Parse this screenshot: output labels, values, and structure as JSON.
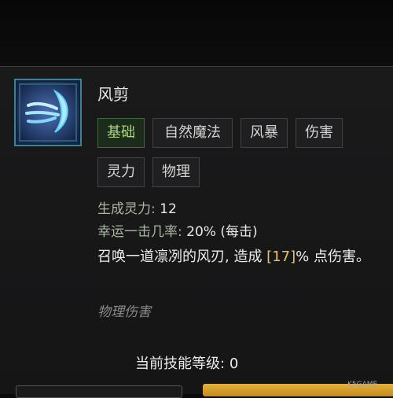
{
  "colors": {
    "accent": "#e8c25a",
    "tag_active": "#a9d67a",
    "panel_bg": "#1a1a1b"
  },
  "skill": {
    "icon": "wind-shear-skill-icon",
    "name": "风剪",
    "tags": [
      "基础",
      "自然魔法",
      "风暴",
      "伤害",
      "灵力",
      "物理"
    ],
    "stats": [
      {
        "label": "生成灵力:",
        "value": "12"
      },
      {
        "label": "幸运一击几率:",
        "value": "20% (每击)"
      }
    ],
    "description": {
      "part1": "召唤一道凛冽的风刃, 造成 ",
      "highlight": "[17]",
      "part2": "% 点伤害。"
    },
    "damage_type": "物理伤害"
  },
  "level": {
    "label": "当前技能等级:",
    "value": "0"
  },
  "watermark": "K5GAME"
}
